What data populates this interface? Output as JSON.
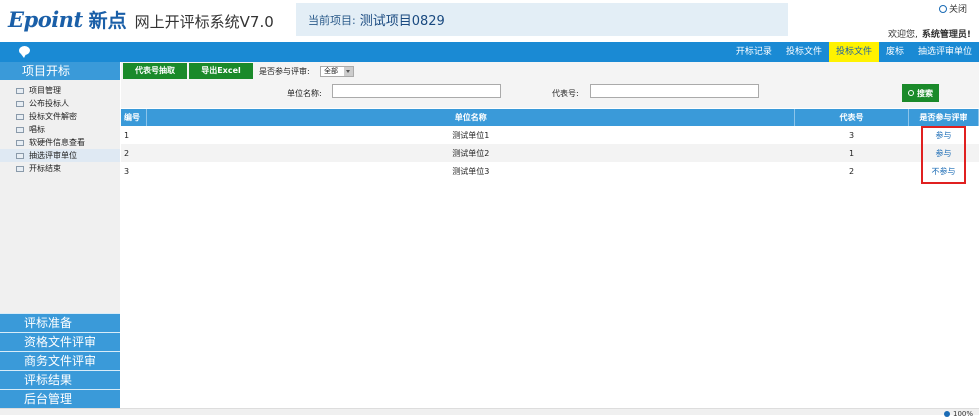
{
  "header": {
    "brand": "Epoint",
    "brand_cn": "新点",
    "system_name": "网上开评标系统V7.0",
    "project_label": "当前项目:",
    "project_name": "测试项目0829",
    "close_label": "关闭",
    "welcome_text": "欢迎您,",
    "user_name": "系统管理员!"
  },
  "nav": {
    "tabs": [
      {
        "label": "开标记录",
        "active": false
      },
      {
        "label": "投标文件",
        "active": false
      },
      {
        "label": "投标文件",
        "active": true
      },
      {
        "label": "废标",
        "active": false
      },
      {
        "label": "抽选评审单位",
        "active": false
      }
    ],
    "chat_icon": "chat-bubble-icon"
  },
  "sidebar": {
    "title": "项目开标",
    "items": [
      {
        "label": "项目管理"
      },
      {
        "label": "公布投标人"
      },
      {
        "label": "投标文件解密"
      },
      {
        "label": "唱标"
      },
      {
        "label": "软硬件信息查看"
      },
      {
        "label": "抽选评审单位",
        "active": true
      },
      {
        "label": "开标结束"
      }
    ],
    "sections": [
      {
        "label": "评标准备"
      },
      {
        "label": "资格文件评审"
      },
      {
        "label": "商务文件评审"
      },
      {
        "label": "评标结果"
      },
      {
        "label": "后台管理"
      }
    ]
  },
  "toolbar": {
    "extract_button": "代表号抽取",
    "export_button": "导出Excel",
    "filter_label": "是否参与评审:",
    "filter_value": "全部"
  },
  "search": {
    "unit_label": "单位名称:",
    "unit_value": "",
    "code_label": "代表号:",
    "code_value": "",
    "search_button": "搜索"
  },
  "table": {
    "headers": {
      "no": "编号",
      "name": "单位名称",
      "code": "代表号",
      "participate": "是否参与评审"
    },
    "rows": [
      {
        "no": "1",
        "name": "测试单位1",
        "code": "3",
        "participate": "参与"
      },
      {
        "no": "2",
        "name": "测试单位2",
        "code": "1",
        "participate": "参与"
      },
      {
        "no": "3",
        "name": "测试单位3",
        "code": "2",
        "participate": "不参与"
      }
    ]
  },
  "status": {
    "zoom": "100%"
  },
  "colors": {
    "nav_blue": "#1a8ad4",
    "side_blue": "#3a9ad9",
    "button_green": "#1a8a2a",
    "active_tab": "#fff200",
    "highlight_red": "#e02020"
  }
}
